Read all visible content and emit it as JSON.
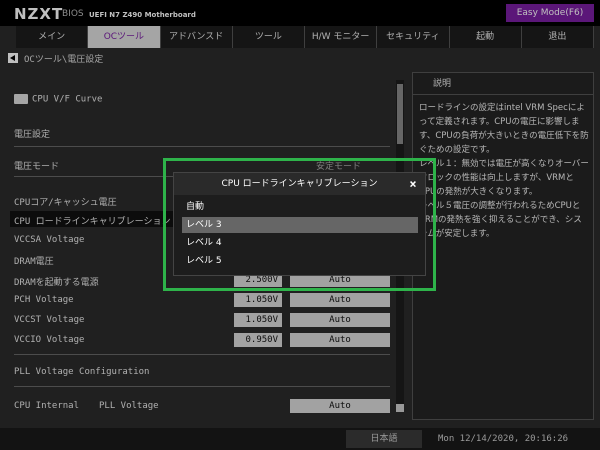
{
  "header": {
    "brand": "NZXT",
    "bios": "BIOS",
    "model": "UEFI N7 Z490 Motherboard",
    "mode_button": "Easy Mode(F6)"
  },
  "tabs": [
    {
      "label": "メイン"
    },
    {
      "label": "OCツール"
    },
    {
      "label": "アドバンスド"
    },
    {
      "label": "ツール"
    },
    {
      "label": "H/W モニター"
    },
    {
      "label": "セキュリティ"
    },
    {
      "label": "起動"
    },
    {
      "label": "退出"
    }
  ],
  "breadcrumb": "OCツール\\電圧設定",
  "settings": {
    "cpu_vf_curve": "CPU V/F Curve",
    "voltage_settings": "電圧設定",
    "voltage_mode_label": "電圧モード",
    "voltage_mode_value": "安定モード",
    "cpu_core_cache": "CPUコア/キャッシュ電圧",
    "cpu_loadline": "CPU ロードラインキャリブレーション",
    "vccsa": "VCCSA Voltage",
    "dram_voltage": "DRAM電圧",
    "dram_boot": "DRAMを起動する電源",
    "dram_boot_value": "2.500V",
    "dram_boot_auto": "Auto",
    "pch": "PCH Voltage",
    "pch_value": "1.050V",
    "pch_auto": "Auto",
    "vccst": "VCCST Voltage",
    "vccst_value": "1.050V",
    "vccst_auto": "Auto",
    "vccio": "VCCIO Voltage",
    "vccio_value": "0.950V",
    "vccio_auto": "Auto",
    "pll_config": "PLL Voltage Configuration",
    "cpu_internal": "CPU Internal",
    "pll_voltage": "PLL Voltage",
    "pll_auto": "Auto"
  },
  "help": {
    "title": "説明",
    "text": "ロードラインの設定はintel VRM Specによって定義されます。CPUの電圧に影響します、CPUの負荷が大きいときの電圧低下を防ぐための設定です。\nレベル１：無効では電圧が高くなりオーバークロックの性能は向上しますが、VRMとCPUの発熱が大きくなります。\nレベル５電圧の調整が行われるためCPUとVRMの発熱を強く抑えることができ、システムが安定します。"
  },
  "popup": {
    "title": "CPU ロードラインキャリブレーション",
    "close": "×",
    "options": [
      {
        "label": "自動",
        "selected": false
      },
      {
        "label": "レベル 3",
        "selected": true
      },
      {
        "label": "レベル 4",
        "selected": false
      },
      {
        "label": "レベル 5",
        "selected": false
      }
    ]
  },
  "footer": {
    "language": "日本語",
    "datetime": "Mon 12/14/2020, 20:16:26"
  },
  "colors": {
    "accent": "#7a1fa2",
    "highlight_box": "#2eb34a"
  }
}
